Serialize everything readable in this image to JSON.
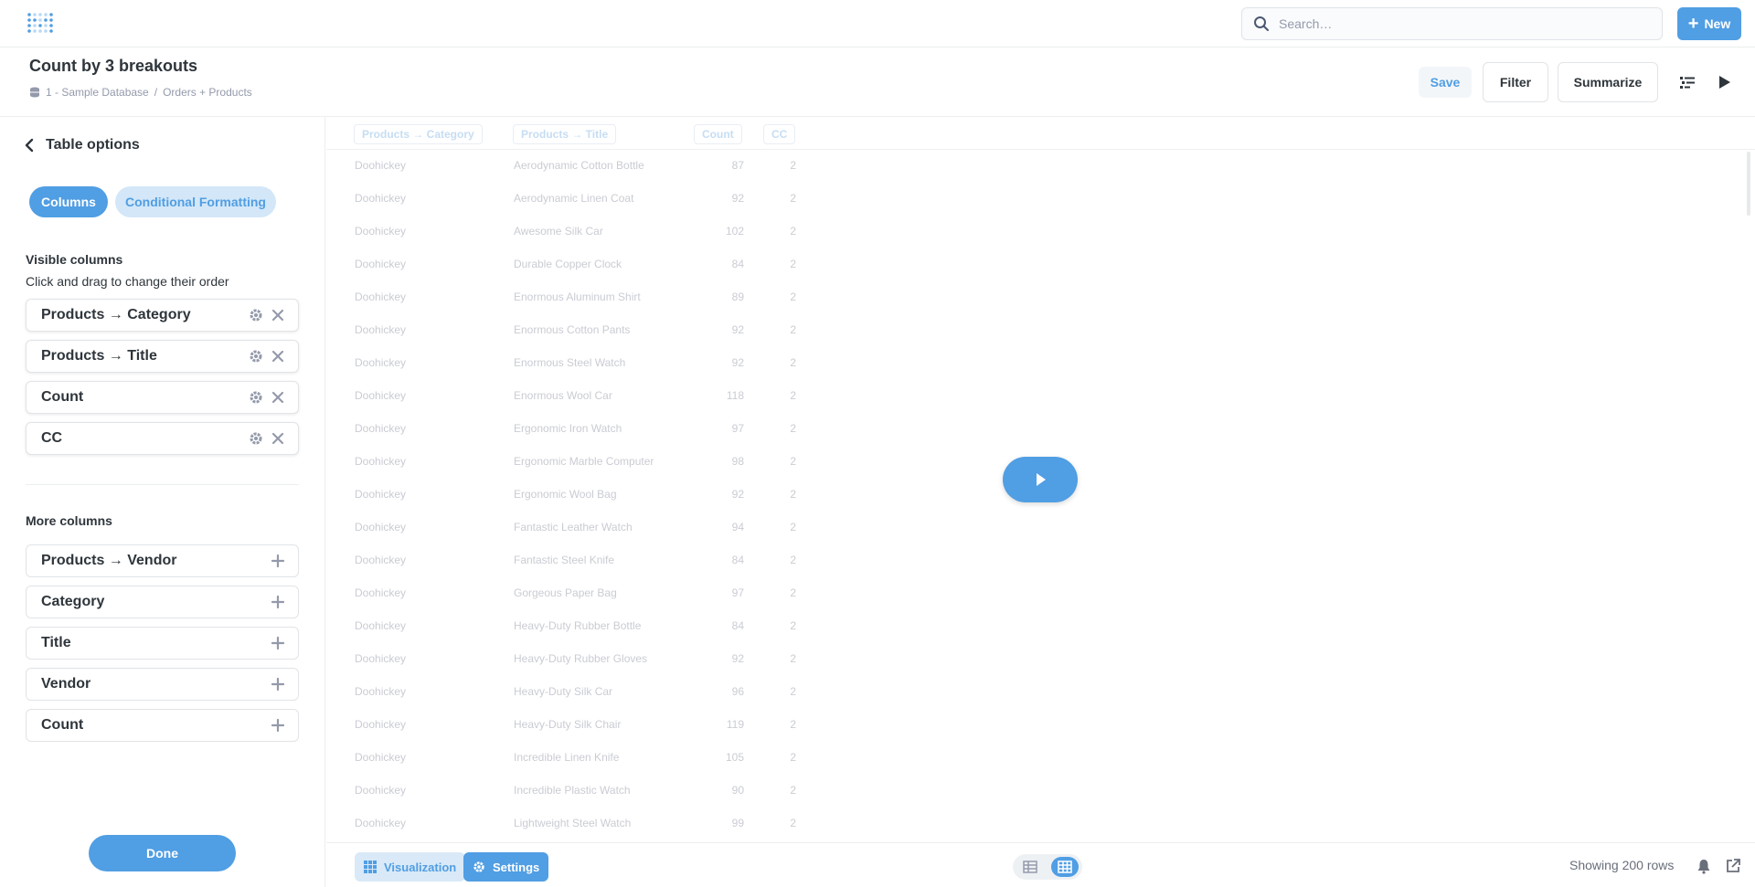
{
  "topnav": {
    "search_placeholder": "Search…",
    "new_label": "New"
  },
  "header": {
    "title": "Count by 3 breakouts",
    "database": "1 - Sample Database",
    "separator": "/",
    "table": "Orders + Products",
    "save_label": "Save",
    "filter_label": "Filter",
    "summarize_label": "Summarize"
  },
  "sidebar": {
    "back_label": "Table options",
    "tab_columns": "Columns",
    "tab_conditional": "Conditional Formatting",
    "visible_title": "Visible columns",
    "visible_hint": "Click and drag to change their order",
    "visible_columns": [
      "Products → Category",
      "Products → Title",
      "Count",
      "CC"
    ],
    "more_title": "More columns",
    "more_columns": [
      "Products → Vendor",
      "Category",
      "Title",
      "Vendor",
      "Count"
    ],
    "done_label": "Done"
  },
  "table": {
    "headers": [
      "Products → Category",
      "Products → Title",
      "Count",
      "CC"
    ],
    "rows": [
      [
        "Doohickey",
        "Aerodynamic Cotton Bottle",
        "87",
        "2"
      ],
      [
        "Doohickey",
        "Aerodynamic Linen Coat",
        "92",
        "2"
      ],
      [
        "Doohickey",
        "Awesome Silk Car",
        "102",
        "2"
      ],
      [
        "Doohickey",
        "Durable Copper Clock",
        "84",
        "2"
      ],
      [
        "Doohickey",
        "Enormous Aluminum Shirt",
        "89",
        "2"
      ],
      [
        "Doohickey",
        "Enormous Cotton Pants",
        "92",
        "2"
      ],
      [
        "Doohickey",
        "Enormous Steel Watch",
        "92",
        "2"
      ],
      [
        "Doohickey",
        "Enormous Wool Car",
        "118",
        "2"
      ],
      [
        "Doohickey",
        "Ergonomic Iron Watch",
        "97",
        "2"
      ],
      [
        "Doohickey",
        "Ergonomic Marble Computer",
        "98",
        "2"
      ],
      [
        "Doohickey",
        "Ergonomic Wool Bag",
        "92",
        "2"
      ],
      [
        "Doohickey",
        "Fantastic Leather Watch",
        "94",
        "2"
      ],
      [
        "Doohickey",
        "Fantastic Steel Knife",
        "84",
        "2"
      ],
      [
        "Doohickey",
        "Gorgeous Paper Bag",
        "97",
        "2"
      ],
      [
        "Doohickey",
        "Heavy-Duty Rubber Bottle",
        "84",
        "2"
      ],
      [
        "Doohickey",
        "Heavy-Duty Rubber Gloves",
        "92",
        "2"
      ],
      [
        "Doohickey",
        "Heavy-Duty Silk Car",
        "96",
        "2"
      ],
      [
        "Doohickey",
        "Heavy-Duty Silk Chair",
        "119",
        "2"
      ],
      [
        "Doohickey",
        "Incredible Linen Knife",
        "105",
        "2"
      ],
      [
        "Doohickey",
        "Incredible Plastic Watch",
        "90",
        "2"
      ],
      [
        "Doohickey",
        "Lightweight Steel Watch",
        "99",
        "2"
      ]
    ]
  },
  "footer": {
    "visualization_label": "Visualization",
    "settings_label": "Settings",
    "row_count": "Showing 200 rows"
  },
  "colors": {
    "brand": "#509ee3",
    "text_dark": "#2e353b",
    "text_muted": "#949aab"
  }
}
